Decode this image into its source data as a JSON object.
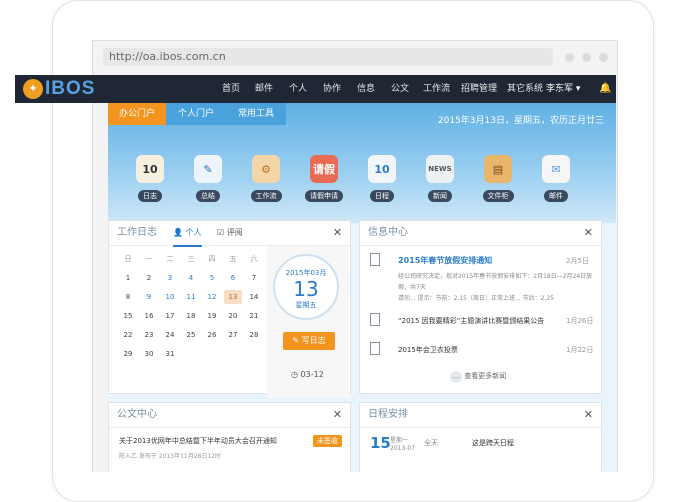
{
  "browser": {
    "url": "http://oa.ibos.com.cn"
  },
  "logo": {
    "text": "IBOS"
  },
  "nav": {
    "items": [
      "首页",
      "邮件",
      "个人",
      "协作",
      "信息",
      "公文",
      "工作流",
      "招聘管理",
      "其它系统"
    ],
    "user": "李东军 ▾"
  },
  "subtabs": [
    "办公门户",
    "个人门户",
    "常用工具"
  ],
  "date_line": "2015年3月13日，星期五，农历正月廿三",
  "apps": [
    {
      "label": "日志",
      "icon": "notebook-icon",
      "color": "#f5f0e0"
    },
    {
      "label": "总结",
      "icon": "pencil-icon",
      "color": "#eef4fb"
    },
    {
      "label": "工作流",
      "icon": "gear-icon",
      "color": "#f4d5a8"
    },
    {
      "label": "请假申请",
      "icon": "leave-icon",
      "text": "请假",
      "color": "#e96b55"
    },
    {
      "label": "日程",
      "icon": "calendar-icon",
      "text": "10",
      "color": "#f2f6fb"
    },
    {
      "label": "新闻",
      "icon": "newspaper-icon",
      "text": "NEWS",
      "color": "#eef1f4"
    },
    {
      "label": "文件柜",
      "icon": "drawer-icon",
      "color": "#e8b56a"
    },
    {
      "label": "邮件",
      "icon": "mail-icon",
      "color": "#f6f6f6"
    }
  ],
  "worklog": {
    "title": "工作日志",
    "tab_personal": "个人",
    "tab_review": "评阅",
    "weekdays": [
      "日",
      "一",
      "二",
      "三",
      "四",
      "五",
      "六"
    ],
    "weeks": [
      [
        "1",
        "2",
        "3",
        "4",
        "5",
        "6",
        "7"
      ],
      [
        "8",
        "9",
        "10",
        "11",
        "12",
        "13",
        "14"
      ],
      [
        "15",
        "16",
        "17",
        "18",
        "19",
        "20",
        "21"
      ],
      [
        "22",
        "23",
        "24",
        "25",
        "26",
        "27",
        "28"
      ],
      [
        "29",
        "30",
        "31",
        "",
        "",
        "",
        ""
      ]
    ],
    "today": "13",
    "cal_month": "2015年03月",
    "cal_day": "13",
    "cal_weekday": "星期五",
    "write_button": "写日志",
    "time_label": "03-12"
  },
  "info_center": {
    "title": "信息中心",
    "items": [
      {
        "title": "2015年春节放假安排通知",
        "date": "2月5日",
        "excerpt": "经公司研究决定，现对2015年春节放假安排如下：2月18日—2月24日放假，共7天",
        "excerpt2": "请勿... 提示：节前：2.15（周日）正常上班... 节后：2.25"
      },
      {
        "title": "“2015 因我要精彩”主题演讲比赛暨颁结果公告",
        "date": "1月26日"
      },
      {
        "title": "2015年会卫衣投票",
        "date": "1月22日"
      }
    ],
    "more": "查看更多新闻"
  },
  "doc_center": {
    "title": "公文中心",
    "item_title": "关于2013优网年中总结暨下半年动员大会召开通知",
    "badge": "未签收",
    "meta": "陈入乙 发布于 2013年11月28日12时"
  },
  "schedule": {
    "title": "日程安排",
    "day": "15",
    "weekday": "星期一",
    "month": "2013-07",
    "allday": "全天",
    "event": "这是跨天日程"
  }
}
